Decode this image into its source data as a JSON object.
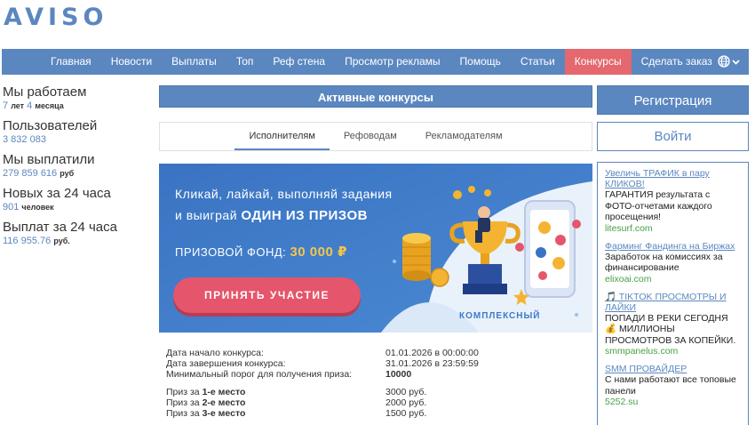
{
  "logo": "AVISO",
  "nav": {
    "items": [
      "Главная",
      "Новости",
      "Выплаты",
      "Топ",
      "Реф стена",
      "Просмотр рекламы",
      "Помощь",
      "Статьи",
      "Конкурсы",
      "Сделать заказ"
    ],
    "active": "Конкурсы",
    "colors": {
      "bar": "#5b87c0",
      "active": "#e4686d"
    }
  },
  "stats": [
    {
      "title": "Мы работаем",
      "v1": "7",
      "u1": "лет",
      "v2": "4",
      "u2": "месяца"
    },
    {
      "title": "Пользователей",
      "value": "3 832 083"
    },
    {
      "title": "Мы выплатили",
      "value": "279 859 616",
      "unit": "руб"
    },
    {
      "title": "Новых за 24 часа",
      "value": "901",
      "unit": "человек"
    },
    {
      "title": "Выплат за 24 часа",
      "value": "116 955.76",
      "unit": "руб."
    }
  ],
  "contest": {
    "header": "Активные конкурсы",
    "tabs": [
      "Исполнителям",
      "Рефоводам",
      "Рекламодателям"
    ],
    "active_tab": "Исполнителям",
    "banner": {
      "line1": "Кликай, лайкай, выполняй задания",
      "line2_prefix": "и выиграй",
      "line2_bold": "ОДИН ИЗ ПРИЗОВ",
      "fund_label": "ПРИЗОВОЙ ФОНД:",
      "fund_value": "30 000 ₽",
      "button": "ПРИНЯТЬ УЧАСТИЕ",
      "caption": "КОМПЛЕКСНЫЙ"
    },
    "details": [
      {
        "label": "Дата начало конкурса:",
        "value": "01.01.2026 в 00:00:00"
      },
      {
        "label": "Дата завершения конкурса:",
        "value": "31.01.2026 в 23:59:59"
      },
      {
        "label": "Минимальный порог для получения приза:",
        "value": "10000"
      }
    ],
    "prizes": [
      {
        "pre": "Приз за",
        "place": "1-е место",
        "value": "3000 руб."
      },
      {
        "pre": "Приз за",
        "place": "2-е место",
        "value": "2000 руб."
      },
      {
        "pre": "Приз за",
        "place": "3-е место",
        "value": "1500 руб."
      }
    ]
  },
  "auth": {
    "register": "Регистрация",
    "login": "Войти"
  },
  "ads": [
    {
      "title": "Увеличь ТРАФИК в пару КЛИКОВ!",
      "text": "ГАРАНТИЯ результата с ФОТО-отчетами каждого просещения!",
      "url": "litesurf.com"
    },
    {
      "title": "Фарминг Фандинга на Биржах",
      "text": "Заработок на комиссиях за финансирование",
      "url": "elixoai.com"
    },
    {
      "title": "🎵 TIKTOK ПРОСМОТРЫ И ЛАЙКИ",
      "text": "ПОПАДИ В РЕКИ СЕГОДНЯ 💰 МИЛЛИОНЫ ПРОСМОТРОВ ЗА КОПЕЙКИ.",
      "url": "smmpanelus.com"
    },
    {
      "title": "SMM ПРОВАЙДЕР",
      "text": "С нами работают все топовые панели",
      "url": "5252.su"
    }
  ]
}
